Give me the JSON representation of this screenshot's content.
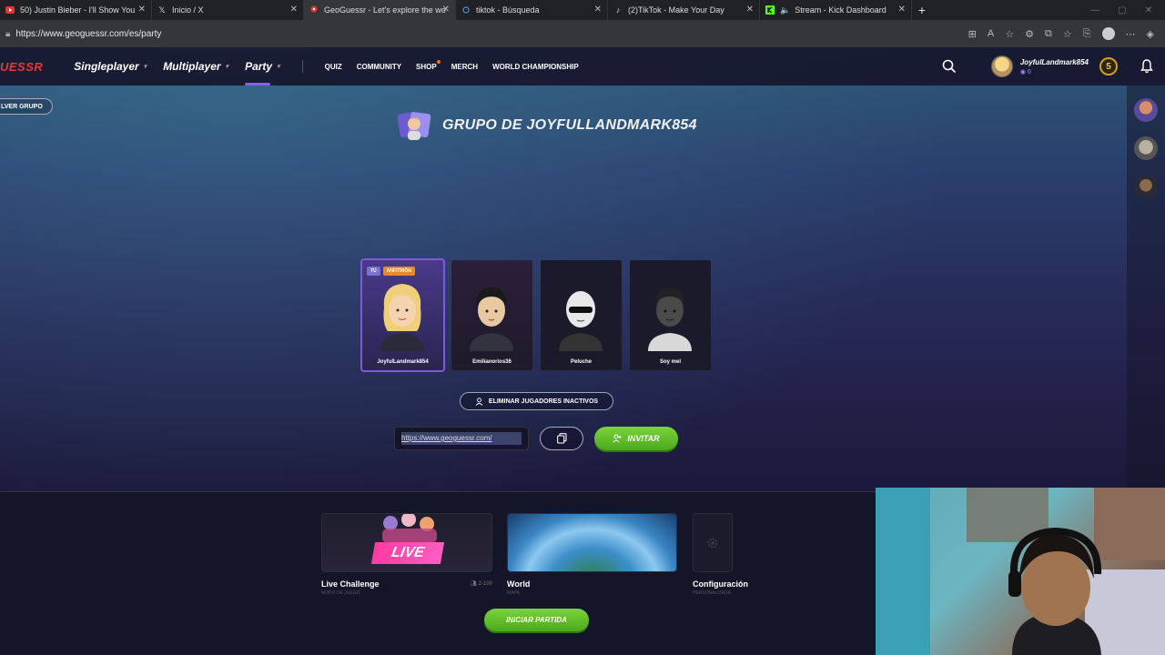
{
  "browser": {
    "tabs": [
      {
        "title": "50) Justin Bieber - I'll Show You",
        "icon": "youtube-icon",
        "active": false
      },
      {
        "title": "Inicio / X",
        "icon": "x-icon",
        "active": false
      },
      {
        "title": "GeoGuessr - Let's explore the wo",
        "icon": "geoguessr-icon",
        "active": true
      },
      {
        "title": "tiktok - Búsqueda",
        "icon": "search-icon",
        "active": false
      },
      {
        "title": "(2)TikTok - Make Your Day",
        "icon": "tiktok-icon",
        "active": false
      },
      {
        "title": "Stream - Kick Dashboard",
        "icon": "kick-icon",
        "active": false
      }
    ],
    "url": "https://www.geoguessr.com/es/party"
  },
  "nav": {
    "logo": "UESSR",
    "main": [
      {
        "label": "Singleplayer",
        "active": false
      },
      {
        "label": "Multiplayer",
        "active": false
      },
      {
        "label": "Party",
        "active": true
      }
    ],
    "sub": [
      "QUIZ",
      "COMMUNITY",
      "SHOP",
      "MERCH",
      "WORLD CHAMPIONSHIP"
    ],
    "username": "JoyfulLandmark854",
    "user_level": "0",
    "coins": "5"
  },
  "leave_label": "LVER GRUPO",
  "group_title": "GRUPO DE JOYFULLANDMARK854",
  "players": [
    {
      "name": "JoyfulLandmark854",
      "badge_you": "TÚ",
      "badge_host": "ANFITRIÓN"
    },
    {
      "name": "Emilianorios36"
    },
    {
      "name": "Peluche"
    },
    {
      "name": "Soy mel"
    }
  ],
  "kick_inactive_label": "ELIMINAR JUGADORES INACTIVOS",
  "invite": {
    "link": "https://www.geoguessr.com/",
    "button_label": "INVITAR"
  },
  "modes": [
    {
      "name": "Live Challenge",
      "sub": "MODO DE JUEGO",
      "banner": "LIVE",
      "players": "2-100"
    },
    {
      "name": "World",
      "sub": "MAPA"
    },
    {
      "name": "Configuración",
      "sub": "PERSONALIZADA"
    }
  ],
  "start_label": "INICIAR PARTIDA",
  "colors": {
    "accent": "#8b5cf6",
    "green": "#5bbf26",
    "brand_red": "#e53935",
    "host_badge": "#e88a2a"
  }
}
